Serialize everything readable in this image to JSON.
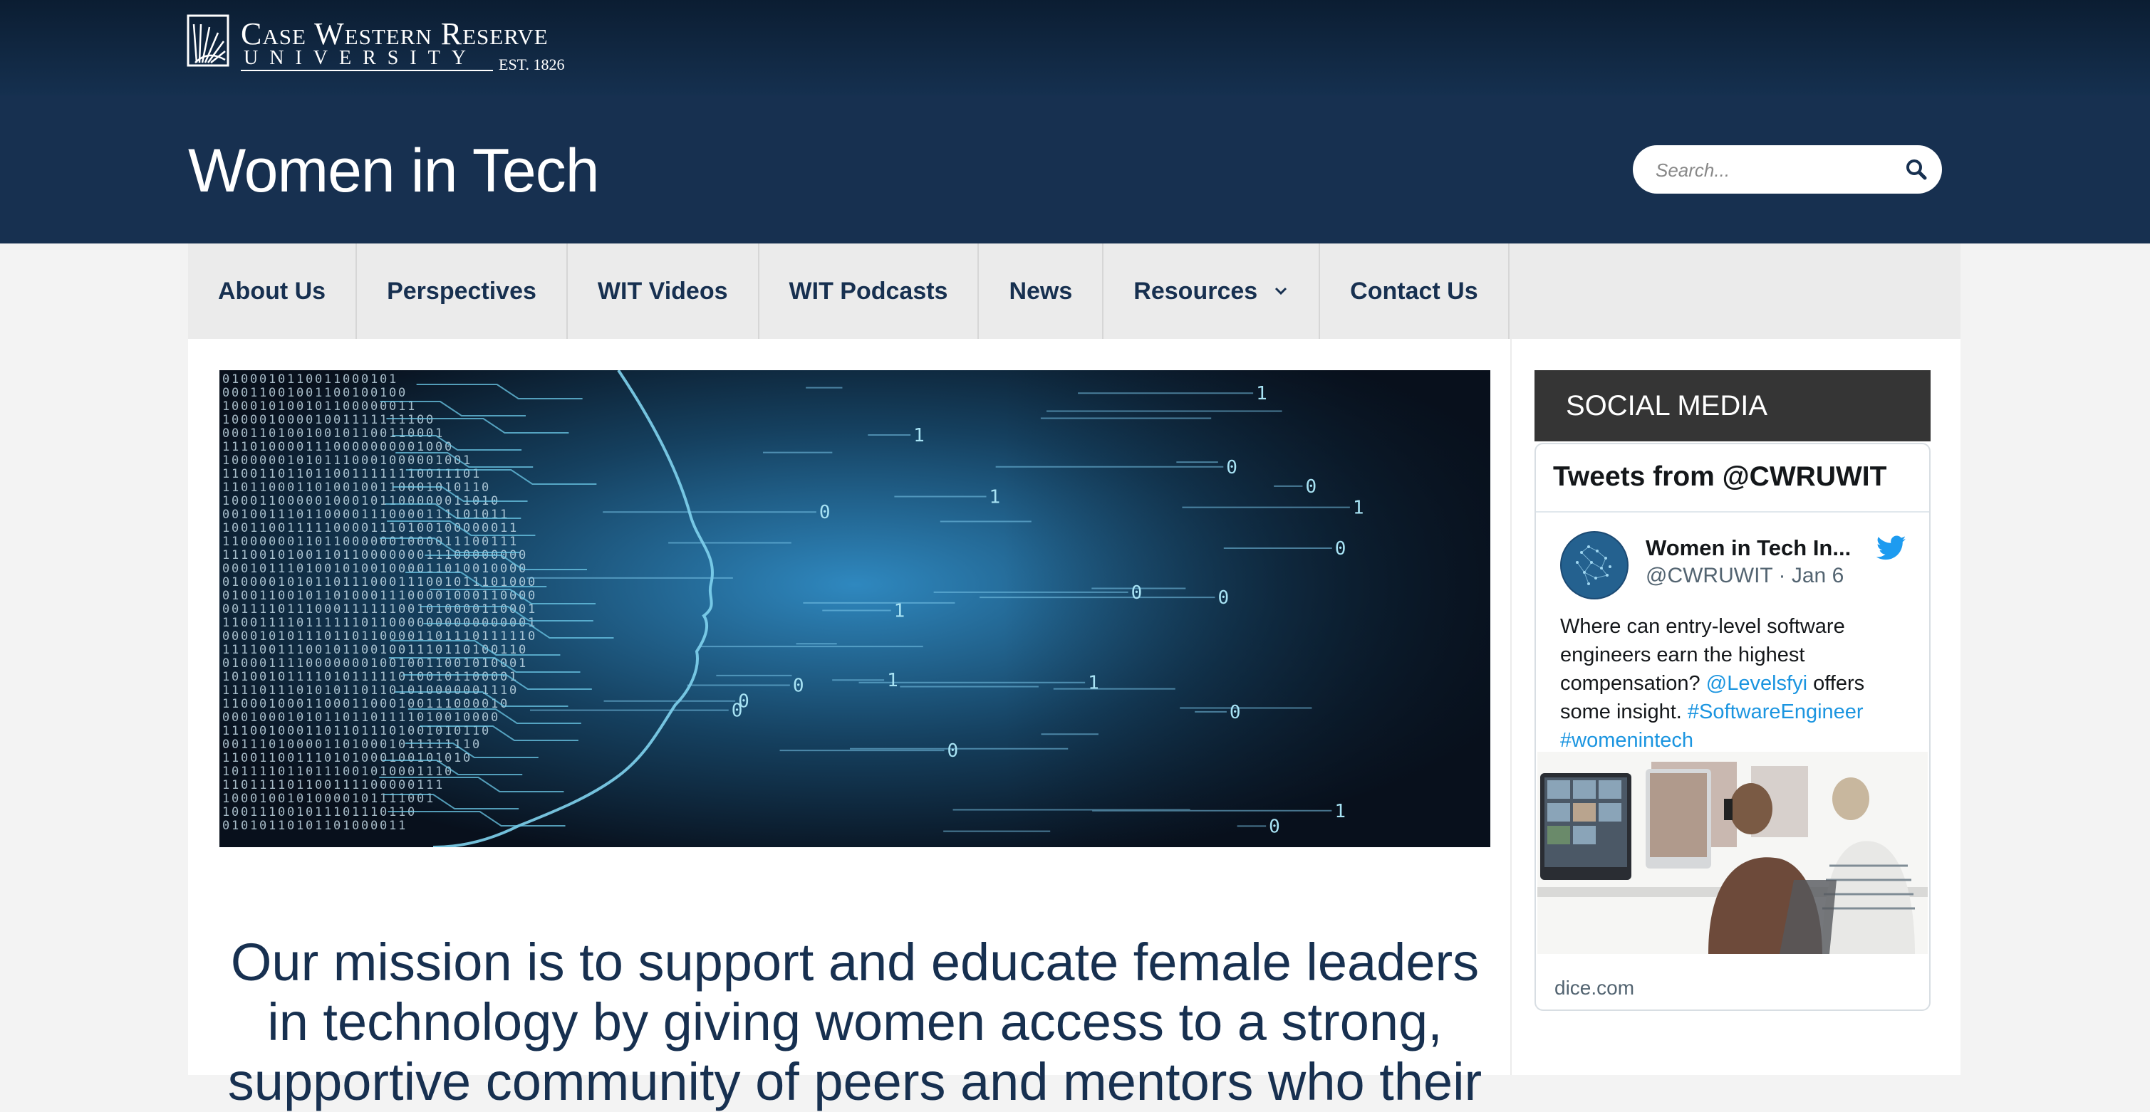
{
  "university": {
    "name": "Case Western Reserve",
    "subline": "UNIVERSITY",
    "established": "EST. 1826"
  },
  "site": {
    "title": "Women in Tech"
  },
  "search": {
    "placeholder": "Search..."
  },
  "nav": {
    "items": [
      {
        "label": "About Us"
      },
      {
        "label": "Perspectives"
      },
      {
        "label": "WIT Videos"
      },
      {
        "label": "WIT Podcasts"
      },
      {
        "label": "News"
      },
      {
        "label": "Resources"
      },
      {
        "label": "Contact Us"
      }
    ]
  },
  "main": {
    "mission": "Our mission is to support and educate female leaders in technology by giving women access to a strong, supportive community of peers and mentors who their"
  },
  "sidebar": {
    "heading": "SOCIAL MEDIA",
    "twitter": {
      "title": "Tweets from @CWRUWIT",
      "display_name": "Women in Tech In...",
      "handle_date": "@CWRUWIT · Jan 6",
      "text_1": "Where can entry-level software engineers earn the highest compensation?",
      "mention": "@Levelsfyi",
      "text_2": "offers some insight.",
      "hashtag_1": "#SoftwareEngineer",
      "hashtag_2": "#womenintech",
      "link_domain": "dice.com"
    }
  },
  "colors": {
    "topbar": "#0b1d32",
    "header": "#173050",
    "nav_bg": "#ebebeb",
    "nav_text": "#173050",
    "social_head": "#353535",
    "twitter_link": "#1b95e0"
  }
}
